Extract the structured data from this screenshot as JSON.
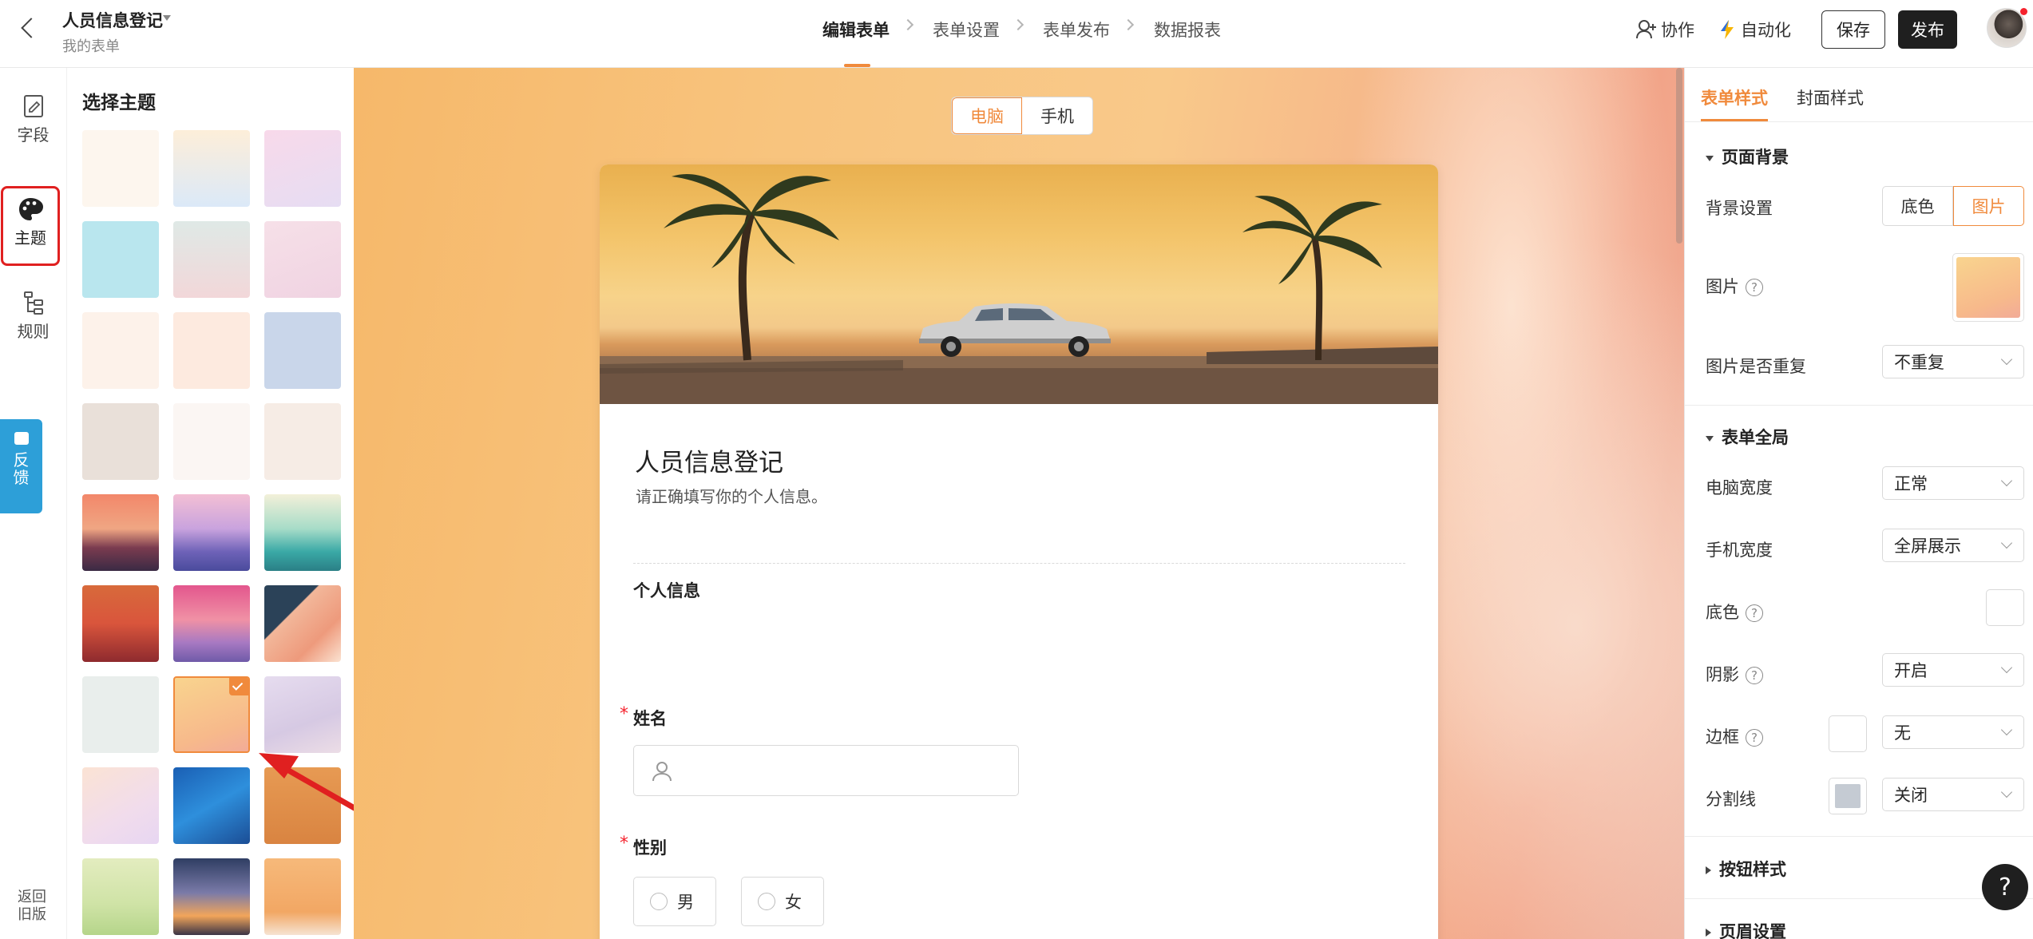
{
  "header": {
    "form_title": "人员信息登记",
    "breadcrumb": "我的表单",
    "steps": [
      "编辑表单",
      "表单设置",
      "表单发布",
      "数据报表"
    ],
    "collab_label": "协作",
    "automation_label": "自动化",
    "save_label": "保存",
    "publish_label": "发布"
  },
  "left_rail": {
    "fields_label": "字段",
    "theme_label": "主题",
    "rules_label": "规则",
    "feedback_label": "反馈",
    "back_old_label": "返回旧版"
  },
  "theme_panel": {
    "title": "选择主题",
    "selected_index": 16
  },
  "canvas": {
    "view_tabs": [
      "电脑",
      "手机"
    ],
    "active_view": "电脑",
    "form": {
      "title": "人员信息登记",
      "description": "请正确填写你的个人信息。",
      "section_title": "个人信息",
      "name_label": "姓名",
      "gender_label": "性别",
      "required_mark": "*",
      "gender_options": [
        "男",
        "女"
      ]
    }
  },
  "right_panel": {
    "tabs": [
      "表单样式",
      "封面样式"
    ],
    "active_tab": "表单样式",
    "page_bg": {
      "title": "页面背景",
      "bg_setting_label": "背景设置",
      "bg_options": [
        "底色",
        "图片"
      ],
      "bg_selected": "图片",
      "image_label": "图片",
      "repeat_label": "图片是否重复",
      "repeat_value": "不重复"
    },
    "form_global": {
      "title": "表单全局",
      "pc_width_label": "电脑宽度",
      "pc_width_value": "正常",
      "mobile_width_label": "手机宽度",
      "mobile_width_value": "全屏展示",
      "bg_color_label": "底色",
      "shadow_label": "阴影",
      "shadow_value": "开启",
      "border_label": "边框",
      "border_value": "无",
      "divider_label": "分割线",
      "divider_value": "关闭"
    },
    "button_style_title": "按钮样式",
    "header_settings_title": "页眉设置",
    "help_icon_text": "?"
  },
  "colors": {
    "accent": "#f08a3c",
    "highlight_red": "#e02020",
    "feedback_blue": "#2d9fd8"
  }
}
